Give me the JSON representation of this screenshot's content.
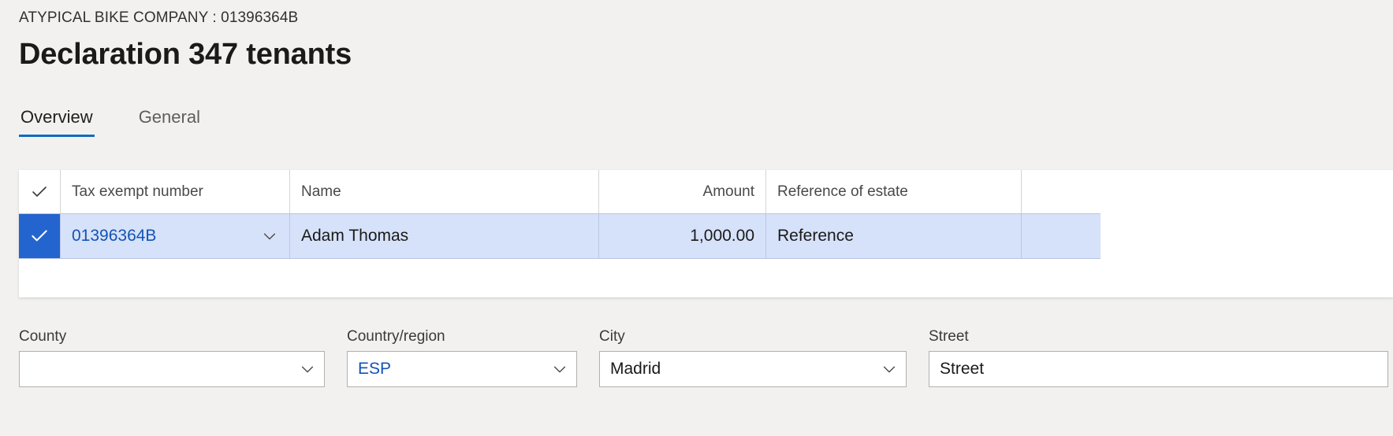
{
  "header": {
    "breadcrumb": "ATYPICAL BIKE COMPANY : 01396364B",
    "title": "Declaration 347 tenants"
  },
  "tabs": [
    {
      "label": "Overview",
      "active": true
    },
    {
      "label": "General",
      "active": false
    }
  ],
  "grid": {
    "select_all_icon": "checkmark-icon",
    "columns": [
      {
        "key": "tax_exempt_number",
        "label": "Tax exempt number",
        "align": "left"
      },
      {
        "key": "name",
        "label": "Name",
        "align": "left"
      },
      {
        "key": "amount",
        "label": "Amount",
        "align": "right"
      },
      {
        "key": "reference_of_estate",
        "label": "Reference of estate",
        "align": "left"
      }
    ],
    "rows": [
      {
        "selected": true,
        "select_icon": "checkmark-icon",
        "tax_exempt_number": "01396364B",
        "tax_exempt_number_dropdown_icon": "chevron-down-icon",
        "name": "Adam Thomas",
        "amount": "1,000.00",
        "reference_of_estate": "Reference"
      }
    ]
  },
  "form": {
    "fields": [
      {
        "label": "County",
        "value": "",
        "placeholder": "",
        "has_dropdown": true,
        "dropdown_icon": "chevron-down-icon",
        "link_style": false
      },
      {
        "label": "Country/region",
        "value": "ESP",
        "placeholder": "",
        "has_dropdown": true,
        "dropdown_icon": "chevron-down-icon",
        "link_style": true
      },
      {
        "label": "City",
        "value": "Madrid",
        "placeholder": "",
        "has_dropdown": true,
        "dropdown_icon": "chevron-down-icon",
        "link_style": false
      },
      {
        "label": "Street",
        "value": "Street",
        "placeholder": "",
        "has_dropdown": false,
        "dropdown_icon": "",
        "link_style": false
      }
    ]
  },
  "colors": {
    "page_background": "#f2f1f0",
    "accent": "#0f6cbd",
    "selection_fill": "#2464cf",
    "selected_row": "#d6e2fa",
    "link_text": "#1253b5"
  }
}
